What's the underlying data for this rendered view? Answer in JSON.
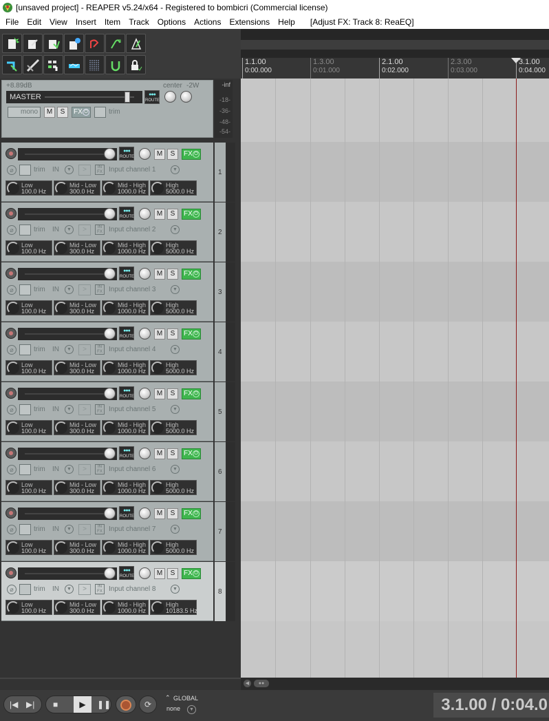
{
  "window": {
    "title": "[unsaved project] - REAPER v5.24/x64 - Registered to bombicri (Commercial license)"
  },
  "menu": {
    "items": [
      "File",
      "Edit",
      "View",
      "Insert",
      "Item",
      "Track",
      "Options",
      "Actions",
      "Extensions",
      "Help"
    ],
    "fx_status": "[Adjust FX: Track 8: ReaEQ]"
  },
  "toolbar": {
    "icons": [
      "new-project-icon",
      "open-project-icon",
      "save-project-icon",
      "project-settings-icon",
      "undo-icon",
      "redo-icon",
      "metronome-icon",
      "snap-icon",
      "ripple-edit-icon",
      "grid-icon",
      "envelope-lock-icon",
      "auto-crossfade-icon",
      "loop-icon",
      "lock-icon"
    ]
  },
  "ruler": {
    "marks": [
      {
        "measure": "1.1.00",
        "time": "0:00.000",
        "minor": false
      },
      {
        "measure": "1.3.00",
        "time": "0:01.000",
        "minor": true
      },
      {
        "measure": "2.1.00",
        "time": "0:02.000",
        "minor": false
      },
      {
        "measure": "2.3.00",
        "time": "0:03.000",
        "minor": true
      },
      {
        "measure": "3.1.00",
        "time": "0:04.000",
        "minor": false
      }
    ]
  },
  "master": {
    "gain": "+8.89dB",
    "pan": "center",
    "width": "-2W",
    "name": "MASTER",
    "route": "ROUTE",
    "mono": "mono",
    "mute": "M",
    "solo": "S",
    "fx": "FX",
    "trim": "trim",
    "meter": {
      "peak": "-inf",
      "ticks": [
        "-18-",
        "-36-",
        "-48-",
        "-54-"
      ]
    }
  },
  "track_common": {
    "route": "ROUTE",
    "mute": "M",
    "solo": "S",
    "fx": "FX",
    "trim": "trim",
    "input_mode": "IN",
    "band_names": [
      "Low",
      "Mid - Low",
      "Mid - High",
      "High"
    ]
  },
  "tracks": [
    {
      "number": "1",
      "input": "Input channel 1",
      "bands": [
        "100.0 Hz",
        "300.0 Hz",
        "1000.0 Hz",
        "5000.0 Hz"
      ],
      "selected": false
    },
    {
      "number": "2",
      "input": "Input channel 2",
      "bands": [
        "100.0 Hz",
        "300.0 Hz",
        "1000.0 Hz",
        "5000.0 Hz"
      ],
      "selected": false
    },
    {
      "number": "3",
      "input": "Input channel 3",
      "bands": [
        "100.0 Hz",
        "300.0 Hz",
        "1000.0 Hz",
        "5000.0 Hz"
      ],
      "selected": false
    },
    {
      "number": "4",
      "input": "Input channel 4",
      "bands": [
        "100.0 Hz",
        "300.0 Hz",
        "1000.0 Hz",
        "5000.0 Hz"
      ],
      "selected": false
    },
    {
      "number": "5",
      "input": "Input channel 5",
      "bands": [
        "100.0 Hz",
        "300.0 Hz",
        "1000.0 Hz",
        "5000.0 Hz"
      ],
      "selected": false
    },
    {
      "number": "6",
      "input": "Input channel 6",
      "bands": [
        "100.0 Hz",
        "300.0 Hz",
        "1000.0 Hz",
        "5000.0 Hz"
      ],
      "selected": false
    },
    {
      "number": "7",
      "input": "Input channel 7",
      "bands": [
        "100.0 Hz",
        "300.0 Hz",
        "1000.0 Hz",
        "5000.0 Hz"
      ],
      "selected": false
    },
    {
      "number": "8",
      "input": "Input channel 8",
      "bands": [
        "100.0 Hz",
        "300.0 Hz",
        "1000.0 Hz",
        "10183.5 Hz"
      ],
      "selected": true
    }
  ],
  "transport": {
    "global_label": "GLOBAL",
    "global_value": "none",
    "time": "3.1.00 / 0:04.0"
  },
  "colors": {
    "fx_active": "#3fb54e",
    "cursor": "#8b1a1a",
    "tcp_bg": "#a9b0b0",
    "tcp_selected": "#cbcfcf",
    "arrange_bg": "#c7c7c7"
  }
}
